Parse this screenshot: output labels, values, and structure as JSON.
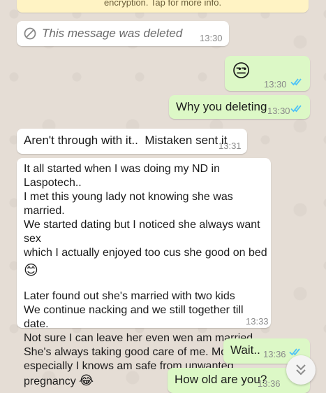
{
  "system_notice": "encryption. Tap for more info.",
  "messages": [
    {
      "deleted_text": "This message was deleted",
      "time": "13:30"
    },
    {
      "emoji": "😒",
      "time": "13:30"
    },
    {
      "text": "Why you deleting",
      "time": "13:30"
    },
    {
      "text": "Aren't through with it..  Mistaken sent it",
      "time": "13:31"
    },
    {
      "p1_lines": [
        "It all started when I was doing my ND in Laspotech..",
        "I met this young lady not knowing she was married.",
        "We started dating but I noticed she always want sex",
        "which I actually enjoyed too cus she good on bed"
      ],
      "p1_emoji": "😊",
      "p2_lines": [
        "Later found out she's married with two kids",
        "We continue nacking and we still together till date.",
        "Not sure I can leave her even wen am married.",
        "She's always taking good care of me. Most",
        "especially I knows am safe from unwanted"
      ],
      "p2_last": "pregnancy",
      "p2_emoji": "😂",
      "time": "13:33"
    },
    {
      "text": "Wait..",
      "time": "13:36"
    },
    {
      "text": "How old are you?",
      "time": "13:36"
    }
  ],
  "colors": {
    "incoming": "#ffffff",
    "outgoing": "#dcf8c6",
    "read_ticks": "#4fc3f7",
    "background": "#e5ddd5"
  }
}
